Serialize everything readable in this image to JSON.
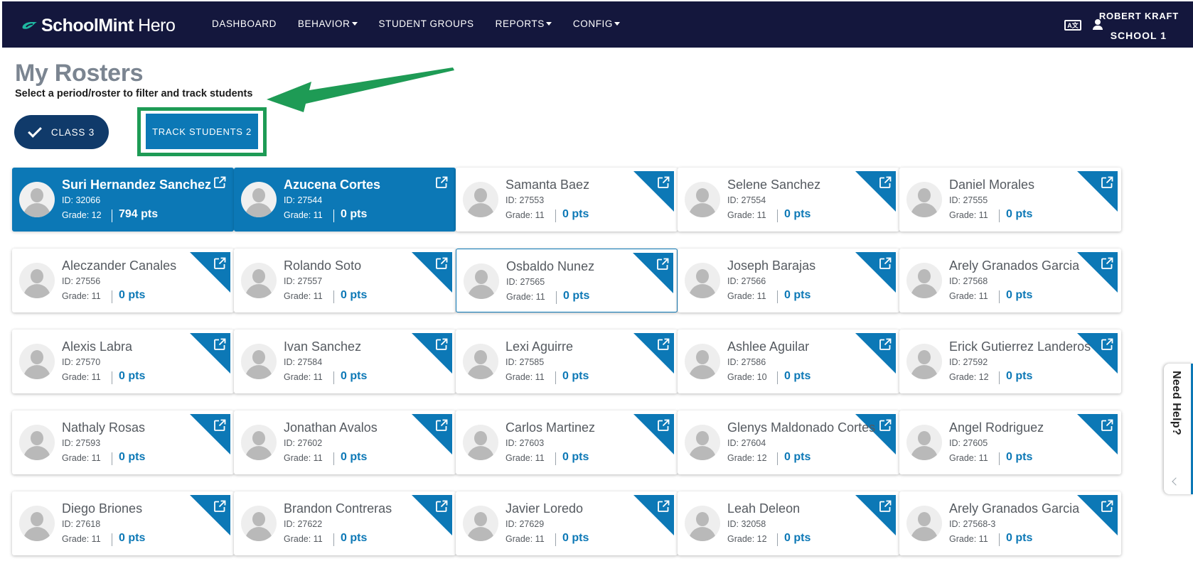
{
  "app": {
    "logo_bold": "SchoolMint",
    "logo_light": " Hero"
  },
  "nav": [
    {
      "label": "DASHBOARD",
      "dropdown": false
    },
    {
      "label": "BEHAVIOR",
      "dropdown": true
    },
    {
      "label": "STUDENT GROUPS",
      "dropdown": false
    },
    {
      "label": "REPORTS",
      "dropdown": true
    },
    {
      "label": "CONFIG",
      "dropdown": true
    }
  ],
  "user": {
    "name": "ROBERT KRAFT",
    "school": "SCHOOL 1",
    "translate_icon": "translate-icon",
    "person_icon": "user-icon"
  },
  "page": {
    "title": "My Rosters",
    "subtitle": "Select a period/roster to filter and track students"
  },
  "roster_button": {
    "label": "CLASS 3",
    "icon": "check-icon"
  },
  "track_button": {
    "label": "TRACK STUDENTS 2"
  },
  "help": {
    "label": "Need Help?"
  },
  "colors": {
    "nav_bg": "#14173d",
    "accent": "#0c78b6",
    "roster_btn": "#103a6a",
    "highlight": "#1e9b55"
  },
  "students": [
    {
      "name": "Suri Hernandez Sanchez",
      "id": "ID: 32066",
      "grade": "Grade: 12",
      "pts": "794 pts",
      "state": "selected"
    },
    {
      "name": "Azucena Cortes",
      "id": "ID: 27544",
      "grade": "Grade: 11",
      "pts": "0 pts",
      "state": "selected"
    },
    {
      "name": "Samanta Baez",
      "id": "ID: 27553",
      "grade": "Grade: 11",
      "pts": "0 pts",
      "state": "normal"
    },
    {
      "name": "Selene Sanchez",
      "id": "ID: 27554",
      "grade": "Grade: 11",
      "pts": "0 pts",
      "state": "normal"
    },
    {
      "name": "Daniel Morales",
      "id": "ID: 27555",
      "grade": "Grade: 11",
      "pts": "0 pts",
      "state": "normal"
    },
    {
      "name": "Aleczander Canales",
      "id": "ID: 27556",
      "grade": "Grade: 11",
      "pts": "0 pts",
      "state": "normal"
    },
    {
      "name": "Rolando Soto",
      "id": "ID: 27557",
      "grade": "Grade: 11",
      "pts": "0 pts",
      "state": "normal"
    },
    {
      "name": "Osbaldo Nunez",
      "id": "ID: 27565",
      "grade": "Grade: 11",
      "pts": "0 pts",
      "state": "outlined"
    },
    {
      "name": "Joseph Barajas",
      "id": "ID: 27566",
      "grade": "Grade: 11",
      "pts": "0 pts",
      "state": "normal"
    },
    {
      "name": "Arely Granados Garcia",
      "id": "ID: 27568",
      "grade": "Grade: 11",
      "pts": "0 pts",
      "state": "normal"
    },
    {
      "name": "Alexis Labra",
      "id": "ID: 27570",
      "grade": "Grade: 11",
      "pts": "0 pts",
      "state": "normal"
    },
    {
      "name": "Ivan Sanchez",
      "id": "ID: 27584",
      "grade": "Grade: 11",
      "pts": "0 pts",
      "state": "normal"
    },
    {
      "name": "Lexi Aguirre",
      "id": "ID: 27585",
      "grade": "Grade: 11",
      "pts": "0 pts",
      "state": "normal"
    },
    {
      "name": "Ashlee Aguilar",
      "id": "ID: 27586",
      "grade": "Grade: 10",
      "pts": "0 pts",
      "state": "normal"
    },
    {
      "name": "Erick Gutierrez Landeros",
      "id": "ID: 27592",
      "grade": "Grade: 12",
      "pts": "0 pts",
      "state": "normal"
    },
    {
      "name": "Nathaly Rosas",
      "id": "ID: 27593",
      "grade": "Grade: 11",
      "pts": "0 pts",
      "state": "normal"
    },
    {
      "name": "Jonathan Avalos",
      "id": "ID: 27602",
      "grade": "Grade: 11",
      "pts": "0 pts",
      "state": "normal"
    },
    {
      "name": "Carlos Martinez",
      "id": "ID: 27603",
      "grade": "Grade: 11",
      "pts": "0 pts",
      "state": "normal"
    },
    {
      "name": "Glenys Maldonado Cortes",
      "id": "ID: 27604",
      "grade": "Grade: 12",
      "pts": "0 pts",
      "state": "normal"
    },
    {
      "name": "Angel Rodriguez",
      "id": "ID: 27605",
      "grade": "Grade: 11",
      "pts": "0 pts",
      "state": "normal"
    },
    {
      "name": "Diego Briones",
      "id": "ID: 27618",
      "grade": "Grade: 11",
      "pts": "0 pts",
      "state": "normal"
    },
    {
      "name": "Brandon Contreras",
      "id": "ID: 27622",
      "grade": "Grade: 11",
      "pts": "0 pts",
      "state": "normal"
    },
    {
      "name": "Javier Loredo",
      "id": "ID: 27629",
      "grade": "Grade: 11",
      "pts": "0 pts",
      "state": "normal"
    },
    {
      "name": "Leah Deleon",
      "id": "ID: 32058",
      "grade": "Grade: 12",
      "pts": "0 pts",
      "state": "normal"
    },
    {
      "name": "Arely Granados Garcia",
      "id": "ID: 27568-3",
      "grade": "Grade: 11",
      "pts": "0 pts",
      "state": "normal"
    }
  ]
}
